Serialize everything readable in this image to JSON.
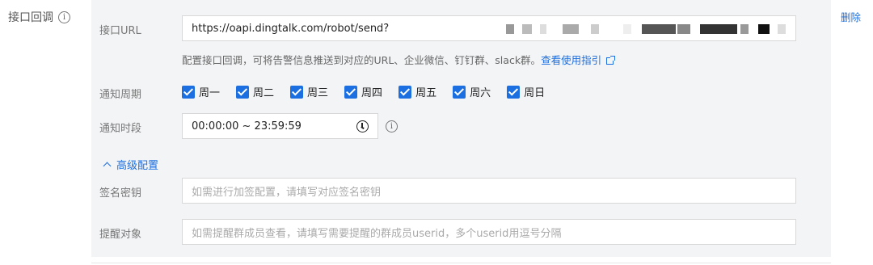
{
  "section": {
    "label": "接口回调"
  },
  "url": {
    "label": "接口URL",
    "value": "https://oapi.dingtalk.com/robot/send?"
  },
  "hint": {
    "text": "配置接口回调，可将告警信息推送到对应的URL、企业微信、钉钉群、slack群。",
    "link": "查看使用指引"
  },
  "period": {
    "label": "通知周期",
    "days": [
      {
        "label": "周一",
        "checked": true
      },
      {
        "label": "周二",
        "checked": true
      },
      {
        "label": "周三",
        "checked": true
      },
      {
        "label": "周四",
        "checked": true
      },
      {
        "label": "周五",
        "checked": true
      },
      {
        "label": "周六",
        "checked": true
      },
      {
        "label": "周日",
        "checked": true
      }
    ]
  },
  "timerange": {
    "label": "通知时段",
    "value": "00:00:00 ~ 23:59:59"
  },
  "advanced": {
    "label": "高级配置"
  },
  "sign": {
    "label": "签名密钥",
    "placeholder": "如需进行加签配置，请填写对应签名密钥"
  },
  "remind": {
    "label": "提醒对象",
    "placeholder": "如需提醒群成员查看，请填写需要提醒的群成员userid，多个userid用逗号分隔"
  },
  "actions": {
    "delete": "删除"
  },
  "colors": {
    "accent": "#1b6fe0",
    "panel": "#f3f4f6"
  }
}
